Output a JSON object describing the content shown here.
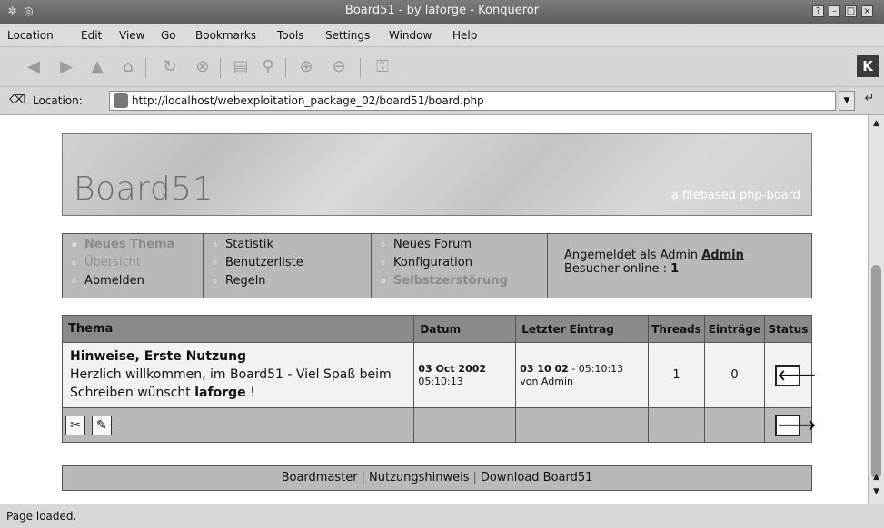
{
  "window": {
    "title": "Board51 - by laforge - Konqueror"
  },
  "menu": [
    "Location",
    "Edit",
    "View",
    "Go",
    "Bookmarks",
    "Tools",
    "Settings",
    "Window",
    "Help"
  ],
  "location": {
    "label": "Location:",
    "url": "http://localhost/webexploitation_package_02/board51/board.php"
  },
  "banner": {
    "logo": "Board51",
    "tagline": "a filebased php-board"
  },
  "nav": {
    "col1": [
      "Neues Thema",
      "Übersicht",
      "Abmelden"
    ],
    "col2": [
      "Statistik",
      "Benutzerliste",
      "Regeln"
    ],
    "col3": [
      "Neues Forum",
      "Konfiguration",
      "Selbstzerstörung"
    ],
    "login_prefix": "Angemeldet als Admin",
    "login_user": "Admin",
    "visitors_prefix": "Besucher online :",
    "visitors_count": "1"
  },
  "table": {
    "headers": [
      "Thema",
      "Datum",
      "Letzter Eintrag",
      "Threads",
      "Einträge",
      "Status"
    ],
    "row": {
      "title": "Hinweise, Erste Nutzung",
      "desc_pre": "Herzlich willkommen, im Board51 - Viel Spaß beim Schreiben wünscht",
      "desc_user": "laforge",
      "desc_post": "!",
      "date_day": "03 Oct 2002",
      "date_time": "05:10:13",
      "last_date": "03 10 02",
      "last_time": "- 05:10:13",
      "last_by": "von Admin",
      "threads": "1",
      "entries": "0"
    }
  },
  "footer": {
    "links": [
      "Boardmaster",
      "Nutzungshinweis",
      "Download Board51"
    ]
  },
  "status": {
    "text": "Page loaded."
  }
}
